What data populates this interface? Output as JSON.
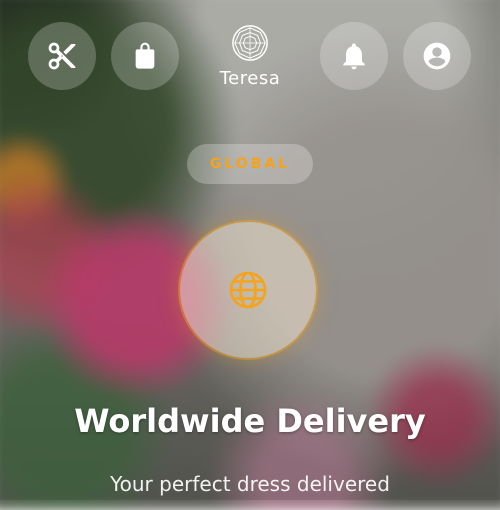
{
  "header": {
    "brand_name": "Teresa",
    "icons": [
      "scissors-icon",
      "shopping-bag-icon",
      "brand-logo",
      "bell-icon",
      "profile-icon"
    ]
  },
  "tag": {
    "label": "GLOBAL"
  },
  "feature": {
    "icon": "globe-icon",
    "title": "Worldwide Delivery",
    "subtitle": "Your perfect dress delivered"
  },
  "colors": {
    "accent": "#f5a31a",
    "text": "#ffffff"
  }
}
